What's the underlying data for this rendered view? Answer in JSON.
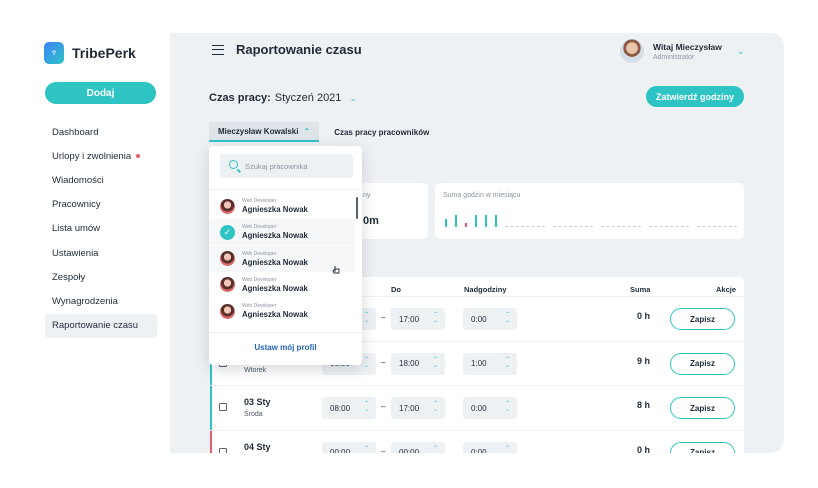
{
  "app": {
    "brand": "TribePerk"
  },
  "sidebar": {
    "add_label": "Dodaj",
    "items": [
      {
        "label": "Dashboard"
      },
      {
        "label": "Urlopy i zwolnienia"
      },
      {
        "label": "Wiadomości"
      },
      {
        "label": "Pracownicy"
      },
      {
        "label": "Lista umów"
      },
      {
        "label": "Ustawienia"
      },
      {
        "label": "Zespoły"
      },
      {
        "label": "Wynagrodzenia"
      },
      {
        "label": "Raportowanie czasu"
      }
    ]
  },
  "header": {
    "title": "Raportowanie czasu",
    "user_name": "Witaj Mieczysław",
    "user_role": "Administrator"
  },
  "toolbar": {
    "period_label": "Czas pracy:",
    "period_value": "Styczeń 2021",
    "approve_label": "Zatwierdź godziny"
  },
  "tabs": [
    {
      "label": "Mieczysław Kowalski"
    },
    {
      "label": "Czas pracy pracowników"
    }
  ],
  "cards": {
    "first_label_fragment": "ny",
    "first_value_fragment": "0m",
    "second_label": "Suma godzin w miesiącu"
  },
  "spark": {
    "bar_heights": [
      0.55,
      0.85,
      0.3,
      0.85,
      0.85,
      0.85
    ],
    "bar_colors": [
      "#2fc4c4",
      "#2fc4c4",
      "#e25c6a",
      "#2fc4c4",
      "#2fc4c4",
      "#2fc4c4"
    ]
  },
  "table": {
    "headers": {
      "do": "Do",
      "overtime": "Nadgodziny",
      "sum": "Suma",
      "actions": "Akcje"
    },
    "save_label": "Zapisz",
    "rows": [
      {
        "date": "",
        "weekday": "",
        "from": "",
        "to": "17:00",
        "overtime": "0:00",
        "sum": "0 h",
        "accent": ""
      },
      {
        "date": "",
        "weekday": "Wtorek",
        "from": "08:00",
        "to": "18:00",
        "overtime": "1:00",
        "sum": "9 h",
        "accent": "#2fc4c4"
      },
      {
        "date": "03 Sty",
        "weekday": "Środa",
        "from": "08:00",
        "to": "17:00",
        "overtime": "0:00",
        "sum": "8 h",
        "accent": "#2fc4c4"
      },
      {
        "date": "04 Sty",
        "weekday": "",
        "from": "00:00",
        "to": "00:00",
        "overtime": "0:00",
        "sum": "0 h",
        "accent": "#e25c6a"
      }
    ]
  },
  "dropdown": {
    "search_placeholder": "Szukaj pracownika",
    "items": [
      {
        "role": "Web Developer",
        "name": "Agnieszka Nowak",
        "selected": false
      },
      {
        "role": "Web Developer",
        "name": "Agnieszka Nowak",
        "selected": true
      },
      {
        "role": "Web Developer",
        "name": "Agnieszka Nowak",
        "selected": false
      },
      {
        "role": "Web Developer",
        "name": "Agnieszka Nowak",
        "selected": false
      },
      {
        "role": "Web Developer",
        "name": "Agnieszka Nowak",
        "selected": false
      }
    ],
    "footer_label": "Ustaw mój profil"
  }
}
